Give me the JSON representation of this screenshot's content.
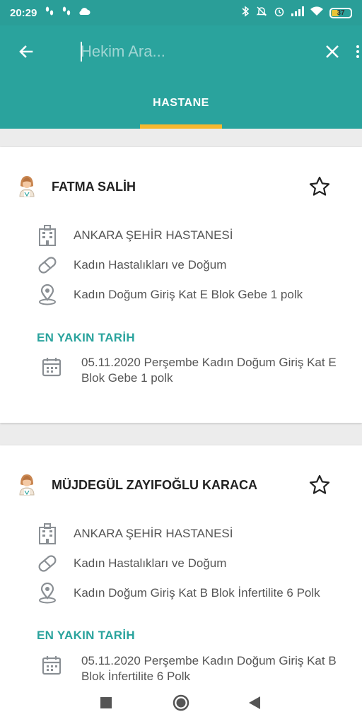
{
  "status_bar": {
    "time": "20:29",
    "battery": "37",
    "battery_level": 0.37
  },
  "search": {
    "placeholder": "Hekim Ara..."
  },
  "tabs": [
    {
      "label": "HASTANE"
    }
  ],
  "colors": {
    "primary": "#2aa39d",
    "accent": "#f5b82e",
    "section_title": "#2aa39d"
  },
  "doctors": [
    {
      "name": "FATMA SALİH",
      "hospital": "ANKARA ŞEHİR HASTANESİ",
      "department": "Kadın Hastalıkları ve Doğum",
      "location": "Kadın Doğum Giriş Kat E Blok Gebe 1 polk",
      "nearest_label": "EN YAKIN TARİH",
      "nearest_date": "05.11.2020 Perşembe Kadın Doğum Giriş Kat E Blok Gebe 1 polk"
    },
    {
      "name": "MÜJDEGÜL ZAYIFOĞLU KARACA",
      "hospital": "ANKARA ŞEHİR HASTANESİ",
      "department": "Kadın Hastalıkları ve Doğum",
      "location": "Kadın Doğum Giriş Kat  B Blok İnfertilite 6 Polk",
      "nearest_label": "EN YAKIN TARİH",
      "nearest_date": "05.11.2020 Perşembe Kadın Doğum Giriş Kat B Blok İnfertilite 6 Polk"
    }
  ]
}
